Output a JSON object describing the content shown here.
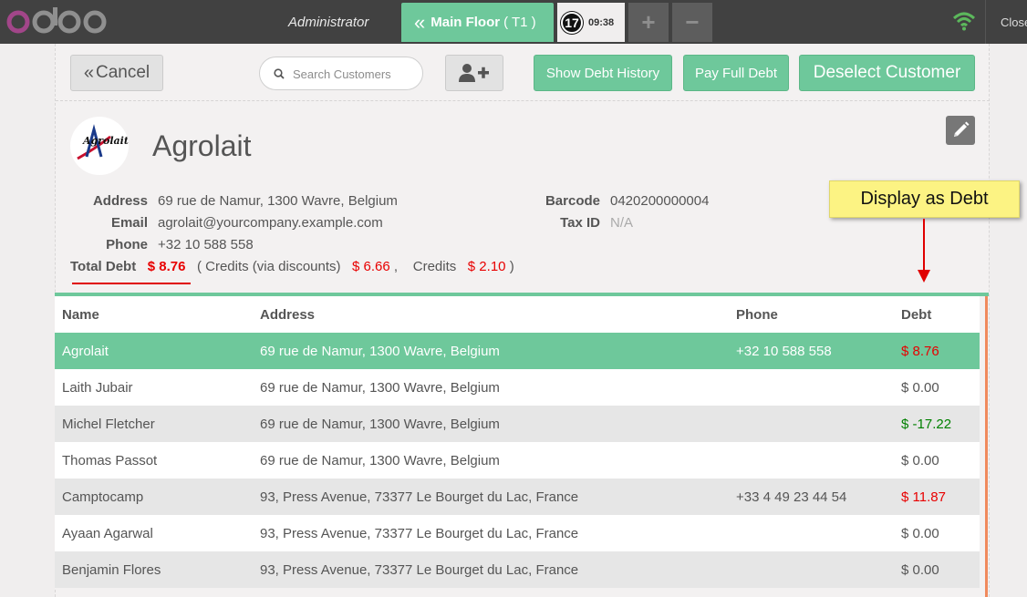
{
  "topbar": {
    "user": "Administrator",
    "floor_tab": {
      "label": "Main Floor",
      "table": "( T1 )"
    },
    "order": {
      "number": "17",
      "time": "09:38"
    },
    "plus": "+",
    "minus": "−",
    "close": "Close"
  },
  "toolbar": {
    "cancel": "Cancel",
    "search_placeholder": "Search Customers",
    "show_debt_history": "Show Debt History",
    "pay_full_debt": "Pay Full Debt",
    "deselect_customer": "Deselect Customer"
  },
  "customer": {
    "name": "Agrolait",
    "logo_text": "Agrolait",
    "address_label": "Address",
    "address": "69 rue de Namur, 1300 Wavre, Belgium",
    "email_label": "Email",
    "email": "agrolait@yourcompany.example.com",
    "phone_label": "Phone",
    "phone": "+32 10 588 558",
    "barcode_label": "Barcode",
    "barcode": "0420200000004",
    "taxid_label": "Tax ID",
    "taxid": "N/A",
    "total_debt_label": "Total Debt",
    "total_debt": "$ 8.76",
    "credits_discount_label": "( Credits (via discounts)",
    "credits_discount": "$ 6.66",
    "comma": ",",
    "credits_label": "Credits",
    "credits": "$ 2.10",
    "close_paren": ")"
  },
  "annotation": {
    "text": "Display as Debt"
  },
  "table": {
    "headers": [
      "Name",
      "Address",
      "Phone",
      "Debt"
    ],
    "rows": [
      {
        "name": "Agrolait",
        "address": "69 rue de Namur, 1300 Wavre, Belgium",
        "phone": "+32 10 588 558",
        "debt": "$ 8.76"
      },
      {
        "name": "Laith Jubair",
        "address": "69 rue de Namur, 1300 Wavre, Belgium",
        "phone": "",
        "debt": "$ 0.00"
      },
      {
        "name": "Michel Fletcher",
        "address": "69 rue de Namur, 1300 Wavre, Belgium",
        "phone": "",
        "debt": "$ -17.22"
      },
      {
        "name": "Thomas Passot",
        "address": "69 rue de Namur, 1300 Wavre, Belgium",
        "phone": "",
        "debt": "$ 0.00"
      },
      {
        "name": "Camptocamp",
        "address": "93, Press Avenue, 73377 Le Bourget du Lac, France",
        "phone": "+33 4 49 23 44 54",
        "debt": "$ 11.87"
      },
      {
        "name": "Ayaan Agarwal",
        "address": "93, Press Avenue, 73377 Le Bourget du Lac, France",
        "phone": "",
        "debt": "$ 0.00"
      },
      {
        "name": "Benjamin Flores",
        "address": "93, Press Avenue, 73377 Le Bourget du Lac, France",
        "phone": "",
        "debt": "$ 0.00"
      }
    ]
  },
  "colors": {
    "accent_green": "#6ec89b",
    "debt_red": "#e80000",
    "credit_green": "#008000",
    "topbar": "#414141",
    "tooltip_yellow": "#fcf383"
  }
}
